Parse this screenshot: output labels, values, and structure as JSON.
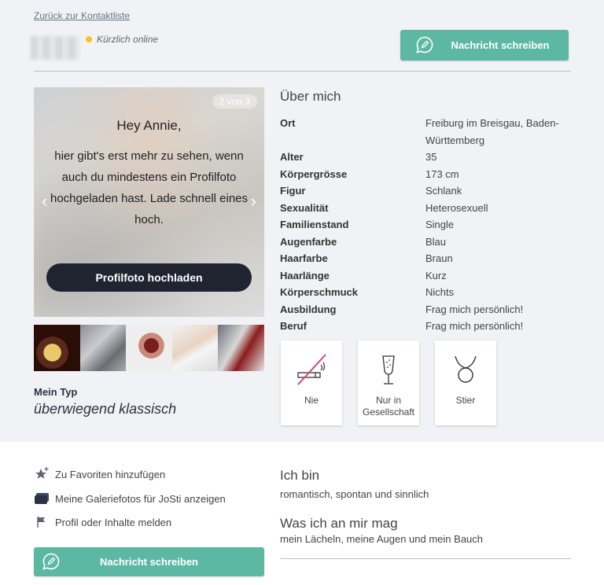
{
  "nav": {
    "back_link": "Zurück zur Kontaktliste"
  },
  "status": {
    "text": "Kürzlich online",
    "color": "#f5c518"
  },
  "buttons": {
    "message": "Nachricht schreiben",
    "upload": "Profilfoto hochladen"
  },
  "photo": {
    "counter": "2 von 3",
    "greeting": "Hey Annie,",
    "message": "hier gibt's erst mehr zu sehen, wenn auch du mindestens ein Profilfoto hochgeladen hast. Lade schnell eines hoch."
  },
  "type": {
    "label": "Mein Typ",
    "value": "überwiegend klassisch"
  },
  "about": {
    "title": "Über mich",
    "attributes": [
      {
        "key": "Ort",
        "value": "Freiburg im Breisgau, Baden-Württemberg"
      },
      {
        "key": "Alter",
        "value": "35"
      },
      {
        "key": "Körpergrösse",
        "value": "173 cm"
      },
      {
        "key": "Figur",
        "value": "Schlank"
      },
      {
        "key": "Sexualität",
        "value": "Heterosexuell"
      },
      {
        "key": "Familienstand",
        "value": "Single"
      },
      {
        "key": "Augenfarbe",
        "value": "Blau"
      },
      {
        "key": "Haarfarbe",
        "value": "Braun"
      },
      {
        "key": "Haarlänge",
        "value": "Kurz"
      },
      {
        "key": "Körperschmuck",
        "value": "Nichts"
      },
      {
        "key": "Ausbildung",
        "value": "Frag mich persönlich!"
      },
      {
        "key": "Beruf",
        "value": "Frag mich persönlich!"
      }
    ]
  },
  "cards": [
    {
      "icon": "no-smoking-icon",
      "label": "Nie"
    },
    {
      "icon": "champagne-glass-icon",
      "label": "Nur in Gesellschaft"
    },
    {
      "icon": "taurus-icon",
      "label": "Stier"
    }
  ],
  "actions": [
    {
      "icon": "star-plus-icon",
      "label": "Zu Favoriten hinzufügen"
    },
    {
      "icon": "gallery-icon",
      "label": "Meine Galeriefotos für JoSti anzeigen"
    },
    {
      "icon": "flag-icon",
      "label": "Profil oder Inhalte melden"
    }
  ],
  "ich_bin": {
    "title": "Ich bin",
    "text": "romantisch, spontan und sinnlich"
  },
  "mag": {
    "title": "Was ich an mir mag",
    "text": "mein Lächeln, meine Augen und mein Bauch"
  },
  "colors": {
    "accent": "#5db8a3",
    "dark_button": "#1f2430",
    "no_smoking_slash": "#d9416b"
  }
}
